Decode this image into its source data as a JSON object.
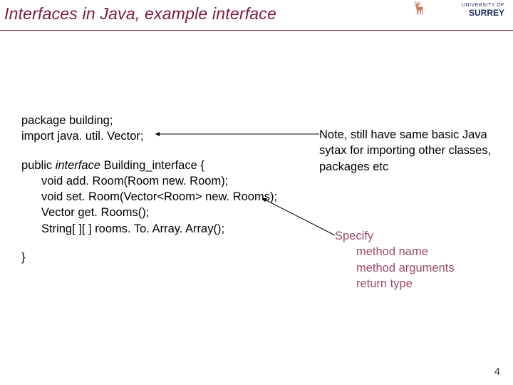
{
  "title": "Interfaces in Java, example interface",
  "logo": {
    "line1": "UNIVERSITY OF",
    "line2": "SURREY"
  },
  "code": {
    "l1": "package building;",
    "l2a": "import java. util. Vector; ",
    "l3a": "public ",
    "l3b": "interface",
    "l3c": " Building_interface {",
    "l4": "void add. Room(Room new. Room);",
    "l5": "void set. Room(Vector<Room> new. Rooms);",
    "l6": "Vector get. Rooms();",
    "l7": "String[ ][ ] rooms. To. Array. Array();",
    "l8": "}"
  },
  "note": "Note, still have same basic Java sytax for importing other classes, packages etc",
  "spec": {
    "head": "Specify",
    "a": "method name",
    "b": "method arguments",
    "c": "return type"
  },
  "page": "4"
}
